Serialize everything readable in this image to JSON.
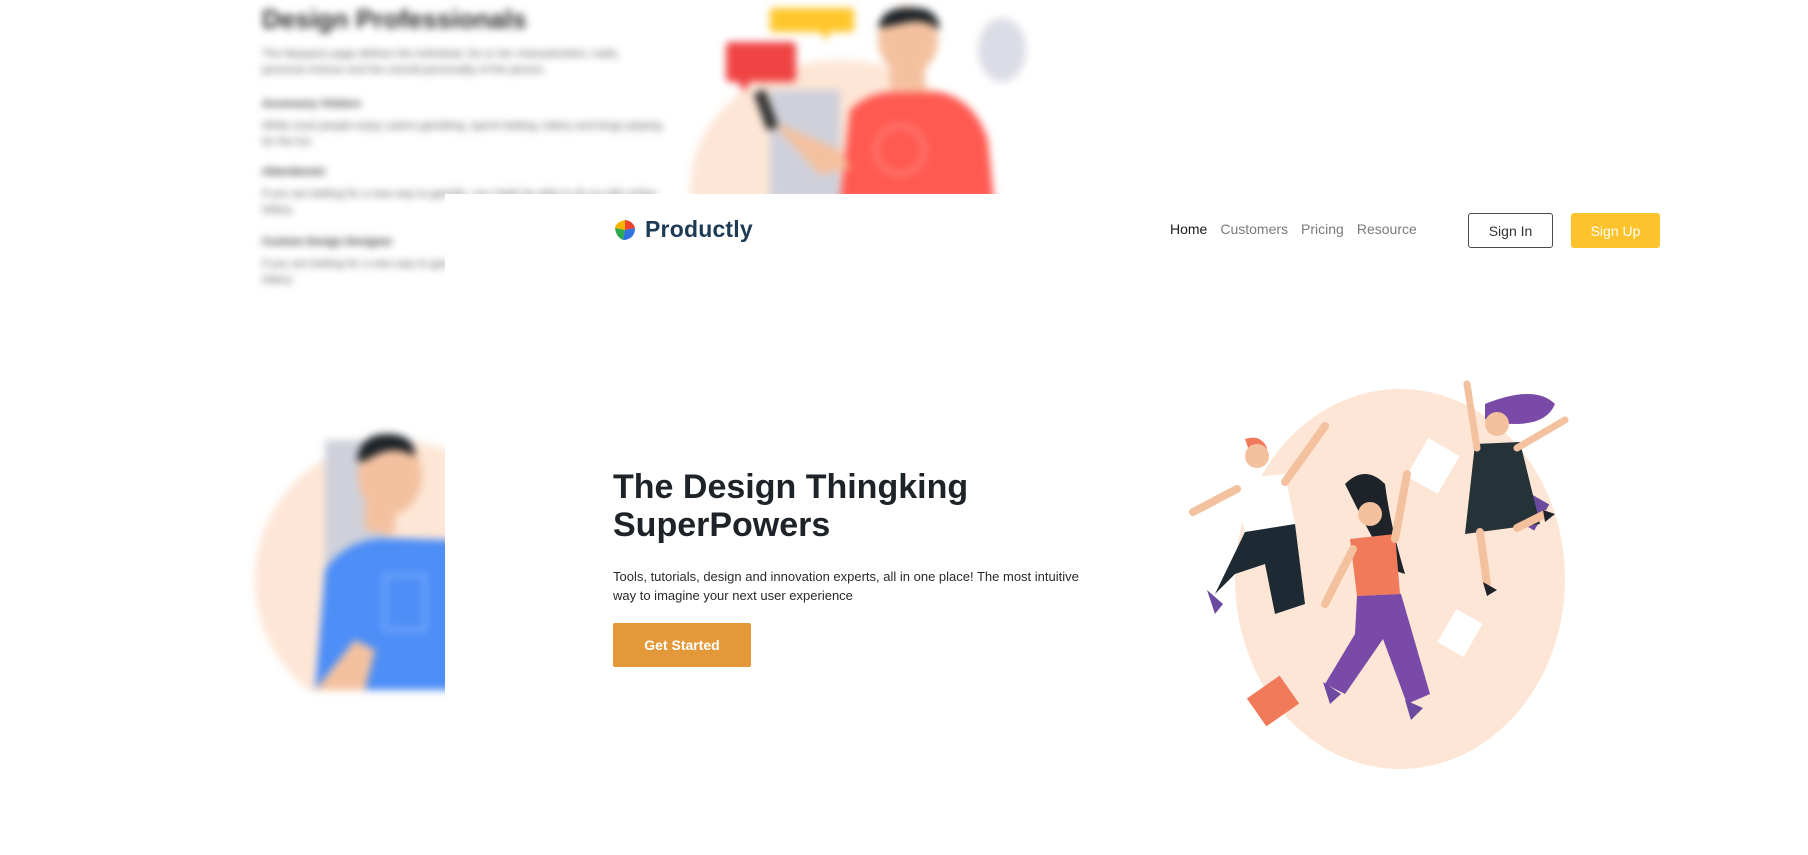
{
  "background_page": {
    "title": "Design Professionals",
    "intro": "The Myspace page defines the individual, his or her characteristics, traits, personal choices and the overall personality of the person.",
    "sections": [
      {
        "heading": "Accessory Visitors",
        "text": "While most people enjoy casino gambling, sports betting, lottery and bingo playing for the fun"
      },
      {
        "heading": "Attendenstv",
        "text": "If you are betting for a new way to gamble, you might be able to do so with online lottery."
      },
      {
        "heading": "Custom Design Designer",
        "text": "If you are betting for a new way to gamble, you might be able to do so with online lottery."
      }
    ]
  },
  "header": {
    "brand": "Productly",
    "nav": [
      {
        "label": "Home",
        "active": true
      },
      {
        "label": "Customers",
        "active": false
      },
      {
        "label": "Pricing",
        "active": false
      },
      {
        "label": "Resource",
        "active": false
      }
    ],
    "signin_label": "Sign In",
    "signup_label": "Sign Up"
  },
  "hero": {
    "title": "The Design Thingking SuperPowers",
    "description": "Tools, tutorials, design and innovation experts, all in one place! The most intuitive way to imagine your next user experience",
    "cta_label": "Get Started"
  },
  "icons": {
    "logo": "productly-logo-icon",
    "hero_image": "jumping-people-illustration"
  },
  "colors": {
    "brand_text": "#1d3b55",
    "signup_bg": "#fcc32c",
    "cta_bg": "#e3993a",
    "nav_active": "#1a1a1a",
    "nav_inactive": "#7a7a7a",
    "illustration_blob": "#fde6d6"
  }
}
